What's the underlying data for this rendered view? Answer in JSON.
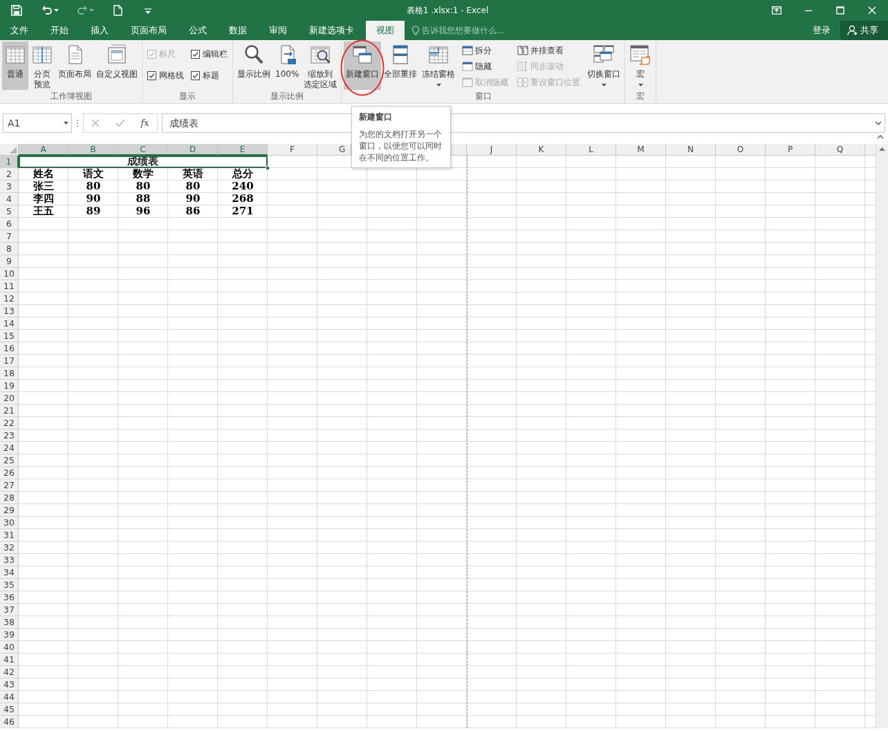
{
  "window": {
    "title": "表格1 .xlsx:1 - Excel"
  },
  "quick_access": [
    {
      "kind": "save",
      "disabled": false,
      "dropdown": false
    },
    {
      "kind": "undo",
      "disabled": false,
      "dropdown": true
    },
    {
      "kind": "redo",
      "disabled": true,
      "dropdown": true
    },
    {
      "kind": "new",
      "disabled": false,
      "dropdown": false
    },
    {
      "kind": "customize",
      "disabled": false,
      "dropdown": false
    }
  ],
  "tabs": [
    {
      "label": "文件",
      "selected": false
    },
    {
      "label": "开始",
      "selected": false
    },
    {
      "label": "插入",
      "selected": false
    },
    {
      "label": "页面布局",
      "selected": false
    },
    {
      "label": "公式",
      "selected": false
    },
    {
      "label": "数据",
      "selected": false
    },
    {
      "label": "审阅",
      "selected": false
    },
    {
      "label": "新建选项卡",
      "selected": false
    },
    {
      "label": "视图",
      "selected": true
    }
  ],
  "tell_me": {
    "placeholder": "告诉我您想要做什么..."
  },
  "account": {
    "sign_in": "登录",
    "share": "共享"
  },
  "ribbon": {
    "groups": [
      {
        "label": "工作簿视图",
        "items": [
          {
            "kind": "large",
            "label": "普通",
            "highlighted": true,
            "circled": false,
            "dropdown": false
          },
          {
            "kind": "large",
            "label": [
              "分页",
              "预览"
            ],
            "highlighted": false,
            "circled": false,
            "dropdown": false
          },
          {
            "kind": "large",
            "label": "页面布局",
            "highlighted": false,
            "circled": false,
            "dropdown": false
          },
          {
            "kind": "large",
            "label": "自定义视图",
            "highlighted": false,
            "circled": false,
            "dropdown": false
          }
        ]
      },
      {
        "label": "显示",
        "items": [
          {
            "kind": "check",
            "label": "标尺",
            "checked": true,
            "disabled": true
          },
          {
            "kind": "check",
            "label": "网格线",
            "checked": true,
            "disabled": false
          },
          {
            "kind": "check",
            "label": "编辑栏",
            "checked": true,
            "disabled": false
          },
          {
            "kind": "check",
            "label": "标题",
            "checked": true,
            "disabled": false
          }
        ]
      },
      {
        "label": "显示比例",
        "items": [
          {
            "kind": "large",
            "label": "显示比例",
            "highlighted": false,
            "circled": false,
            "dropdown": false
          },
          {
            "kind": "large",
            "label": "100%",
            "highlighted": false,
            "circled": false,
            "dropdown": false
          },
          {
            "kind": "large",
            "label": [
              "缩放到",
              "选定区域"
            ],
            "highlighted": false,
            "circled": false,
            "dropdown": false
          }
        ]
      },
      {
        "label": "窗口",
        "items": [
          {
            "kind": "large",
            "label": "新建窗口",
            "highlighted": true,
            "circled": true,
            "dropdown": false
          },
          {
            "kind": "large",
            "label": "全部重排",
            "highlighted": false,
            "circled": false,
            "dropdown": false
          },
          {
            "kind": "large",
            "label": "冻结窗格",
            "highlighted": false,
            "circled": false,
            "dropdown": true
          },
          {
            "kind": "small",
            "label": "拆分",
            "disabled": false
          },
          {
            "kind": "small",
            "label": "隐藏",
            "disabled": false
          },
          {
            "kind": "small",
            "label": "取消隐藏",
            "disabled": true
          },
          {
            "kind": "small",
            "label": "并排查看",
            "disabled": false
          },
          {
            "kind": "small",
            "label": "同步滚动",
            "disabled": true
          },
          {
            "kind": "small",
            "label": "重设窗口位置",
            "disabled": true
          },
          {
            "kind": "large",
            "label": "切换窗口",
            "highlighted": false,
            "circled": false,
            "dropdown": true
          }
        ]
      },
      {
        "label": "宏",
        "items": [
          {
            "kind": "large",
            "label": "宏",
            "highlighted": false,
            "circled": false,
            "dropdown": true
          }
        ]
      }
    ]
  },
  "formula_bar": {
    "name_box": "A1",
    "fx": "fx",
    "formula": "成绩表"
  },
  "sheet": {
    "column_headers_left": [
      {
        "label": "A",
        "selected": true
      },
      {
        "label": "B",
        "selected": true
      },
      {
        "label": "C",
        "selected": true
      },
      {
        "label": "D",
        "selected": true
      },
      {
        "label": "E",
        "selected": true
      },
      {
        "label": "F",
        "selected": false
      },
      {
        "label": "G",
        "selected": false
      }
    ],
    "column_headers_right": [
      {
        "label": "J",
        "selected": false
      },
      {
        "label": "K",
        "selected": false
      },
      {
        "label": "L",
        "selected": false
      },
      {
        "label": "M",
        "selected": false
      },
      {
        "label": "N",
        "selected": false
      },
      {
        "label": "O",
        "selected": false
      },
      {
        "label": "P",
        "selected": false
      },
      {
        "label": "Q",
        "selected": false
      }
    ],
    "rows": [
      {
        "number": "1",
        "selected": true,
        "title": {
          "text": "成绩表",
          "selected": true
        }
      },
      {
        "number": "2",
        "selected": false,
        "cells": [
          "姓名",
          "语文",
          "数学",
          "英语",
          "总分"
        ]
      },
      {
        "number": "3",
        "selected": false,
        "cells": [
          "张三",
          "80",
          "80",
          "80",
          "240"
        ]
      },
      {
        "number": "4",
        "selected": false,
        "cells": [
          "李四",
          "90",
          "88",
          "90",
          "268"
        ]
      },
      {
        "number": "5",
        "selected": false,
        "cells": [
          "王五",
          "89",
          "96",
          "86",
          "271"
        ]
      },
      {
        "number": "6",
        "selected": false
      },
      {
        "number": "7",
        "selected": false
      },
      {
        "number": "8",
        "selected": false
      },
      {
        "number": "9",
        "selected": false
      },
      {
        "number": "10",
        "selected": false
      },
      {
        "number": "11",
        "selected": false
      },
      {
        "number": "12",
        "selected": false
      },
      {
        "number": "13",
        "selected": false
      },
      {
        "number": "14",
        "selected": false
      },
      {
        "number": "15",
        "selected": false
      },
      {
        "number": "16",
        "selected": false
      },
      {
        "number": "17",
        "selected": false
      },
      {
        "number": "18",
        "selected": false
      },
      {
        "number": "19",
        "selected": false
      },
      {
        "number": "20",
        "selected": false
      },
      {
        "number": "21",
        "selected": false
      },
      {
        "number": "22",
        "selected": false
      },
      {
        "number": "23",
        "selected": false
      },
      {
        "number": "24",
        "selected": false
      },
      {
        "number": "25",
        "selected": false
      },
      {
        "number": "26",
        "selected": false
      },
      {
        "number": "27",
        "selected": false
      },
      {
        "number": "28",
        "selected": false
      },
      {
        "number": "29",
        "selected": false
      },
      {
        "number": "30",
        "selected": false
      },
      {
        "number": "31",
        "selected": false
      },
      {
        "number": "32",
        "selected": false
      },
      {
        "number": "33",
        "selected": false
      },
      {
        "number": "34",
        "selected": false
      },
      {
        "number": "35",
        "selected": false
      },
      {
        "number": "36",
        "selected": false
      },
      {
        "number": "37",
        "selected": false
      },
      {
        "number": "38",
        "selected": false
      },
      {
        "number": "39",
        "selected": false
      },
      {
        "number": "40",
        "selected": false
      },
      {
        "number": "41",
        "selected": false
      },
      {
        "number": "42",
        "selected": false
      },
      {
        "number": "43",
        "selected": false
      },
      {
        "number": "44",
        "selected": false
      },
      {
        "number": "45",
        "selected": false
      },
      {
        "number": "46",
        "selected": false
      }
    ]
  },
  "tooltip": {
    "title": "新建窗口",
    "text": "为您的文档打开另一个窗口，以便您可以同时在不同的位置工作。"
  }
}
